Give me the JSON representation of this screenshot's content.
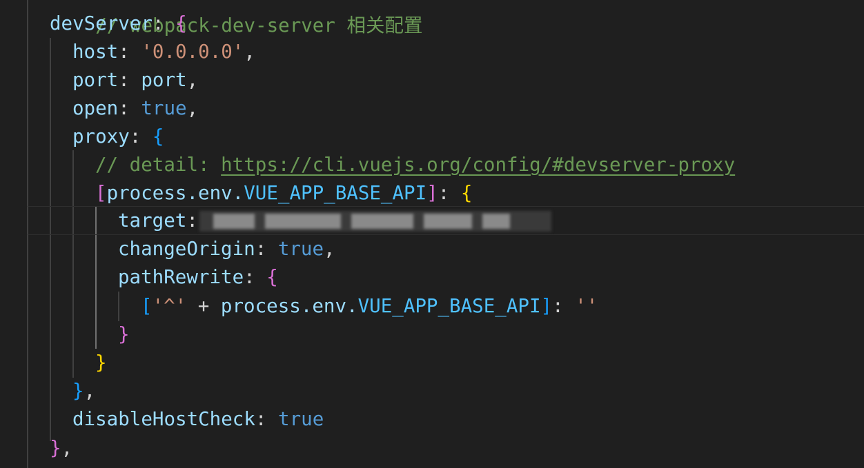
{
  "lines": {
    "l0": {
      "text": "// webpack-dev-server 相关配置"
    },
    "l1": {
      "key": "devServer",
      "colon": ": ",
      "brace": "{"
    },
    "l2": {
      "key": "host",
      "colon": ": ",
      "value": "'0.0.0.0'",
      "comma": ","
    },
    "l3": {
      "key": "port",
      "colon": ": ",
      "value": "port",
      "comma": ","
    },
    "l4": {
      "key": "open",
      "colon": ": ",
      "value": "true",
      "comma": ","
    },
    "l5": {
      "key": "proxy",
      "colon": ": ",
      "brace": "{"
    },
    "l6": {
      "comment": "// detail: ",
      "url": "https://cli.vuejs.org/config/#devserver-proxy"
    },
    "l7": {
      "open_bracket": "[",
      "obj": "process.env.",
      "const": "VUE_APP_BASE_API",
      "close_bracket": "]",
      "colon": ": ",
      "brace": "{"
    },
    "l8": {
      "key": "target",
      "colon": ":"
    },
    "l9": {
      "key": "changeOrigin",
      "colon": ": ",
      "value": "true",
      "comma": ","
    },
    "l10": {
      "key": "pathRewrite",
      "colon": ": ",
      "brace": "{"
    },
    "l11": {
      "open_bracket": "[",
      "str1": "'^'",
      "plus": " + ",
      "obj": "process.env.",
      "const": "VUE_APP_BASE_API",
      "close_bracket": "]",
      "colon": ": ",
      "str2": "''"
    },
    "l12": {
      "brace": "}"
    },
    "l13": {
      "brace": "}"
    },
    "l14": {
      "brace": "}",
      "comma": ","
    },
    "l15": {
      "key": "disableHostCheck",
      "colon": ": ",
      "value": "true"
    },
    "l16": {
      "brace": "}",
      "comma": ","
    }
  },
  "colors": {
    "background": "#1f1f1f",
    "property": "#9cdcfe",
    "string": "#ce9178",
    "keyword": "#569cd6",
    "comment": "#6a9955",
    "constant": "#4fc1ff",
    "bracket_level_1": "#da70d6",
    "bracket_level_2": "#179fff",
    "bracket_level_3": "#ffd700"
  },
  "redacted": "target-url-redacted"
}
